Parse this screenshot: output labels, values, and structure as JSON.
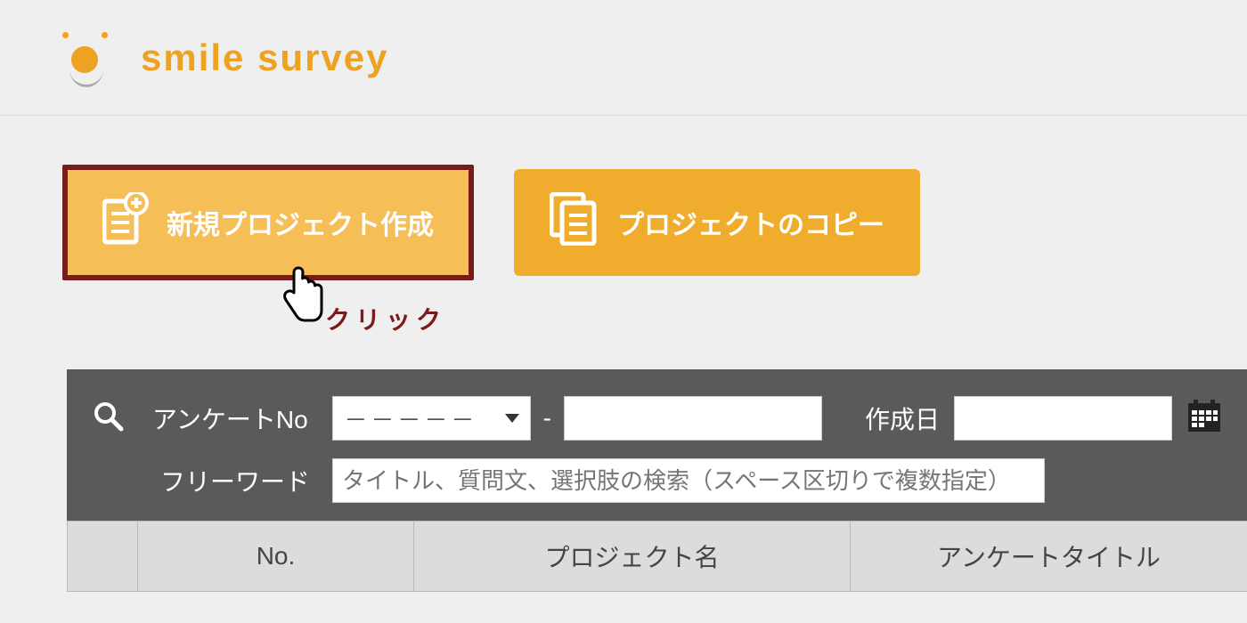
{
  "brand": {
    "name": "smile survey"
  },
  "buttons": {
    "new_project": "新規プロジェクト作成",
    "copy_project": "プロジェクトのコピー"
  },
  "annotation": {
    "click_label": "クリック"
  },
  "filter": {
    "questionnaire_no_label": "アンケートNo",
    "questionnaire_no_value": "－－－－－",
    "created_label": "作成日",
    "created_value": "",
    "freeword_label": "フリーワード",
    "freeword_placeholder": "タイトル、質問文、選択肢の検索（スペース区切りで複数指定）",
    "qno_text_value": ""
  },
  "table": {
    "columns": {
      "no": "No.",
      "project_name": "プロジェクト名",
      "questionnaire_title": "アンケートタイトル"
    }
  }
}
